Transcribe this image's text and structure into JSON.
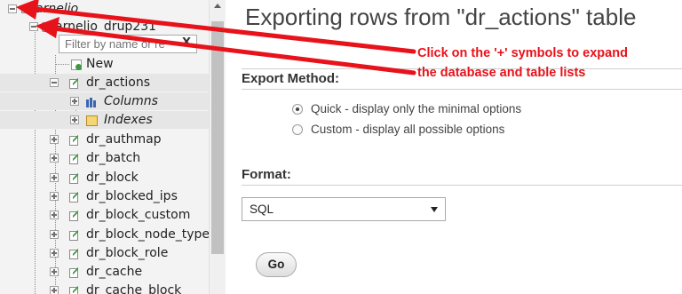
{
  "nav": {
    "server_label": "arnelio",
    "database_label": "arnelio_drup231",
    "filter_placeholder": "Filter by name or re",
    "filter_clear": "X",
    "new_label": "New",
    "tables": [
      {
        "label": "dr_actions",
        "expanded": true
      },
      {
        "label": "dr_authmap"
      },
      {
        "label": "dr_batch"
      },
      {
        "label": "dr_block"
      },
      {
        "label": "dr_blocked_ips"
      },
      {
        "label": "dr_block_custom"
      },
      {
        "label": "dr_block_node_type"
      },
      {
        "label": "dr_block_role"
      },
      {
        "label": "dr_cache"
      },
      {
        "label": "dr_cache_block"
      }
    ],
    "sub_items": [
      {
        "label": "Columns",
        "icon": "columns-icon"
      },
      {
        "label": "Indexes",
        "icon": "indexes-icon"
      }
    ]
  },
  "main": {
    "title": "Exporting rows from \"dr_actions\" table",
    "export_method_label": "Export Method:",
    "export_options": [
      {
        "label": "Quick - display only the minimal options",
        "checked": true
      },
      {
        "label": "Custom - display all possible options",
        "checked": false
      }
    ],
    "format_label": "Format:",
    "format_selected": "SQL",
    "go_label": "Go"
  },
  "annotation": {
    "line1": "Click on the '+' symbols to expand",
    "line2": "the database and table lists",
    "color": "#e8121b"
  },
  "colors": {
    "nav_background": "#f3f3f3",
    "selected_row": "#e6e6e6",
    "title_text": "#444444"
  }
}
